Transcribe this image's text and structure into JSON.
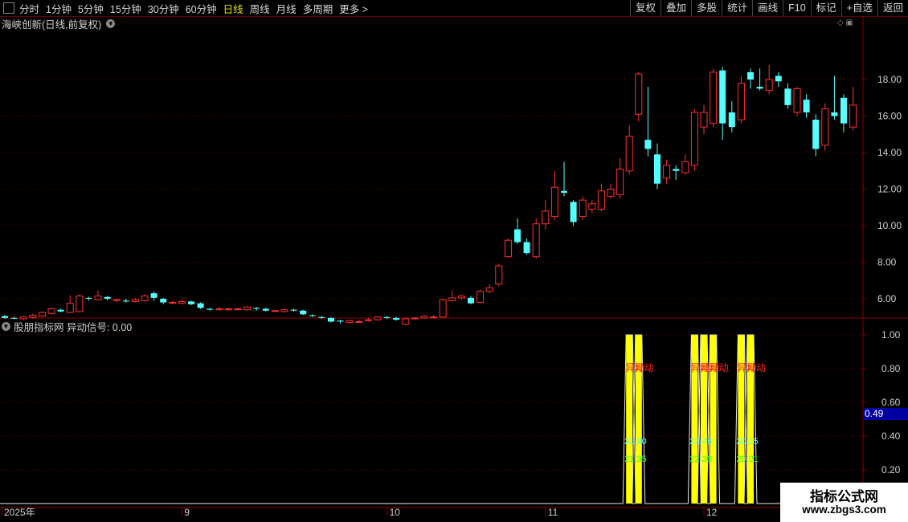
{
  "toolbar": {
    "periods": [
      {
        "label": "分时",
        "active": false
      },
      {
        "label": "1分钟",
        "active": false
      },
      {
        "label": "5分钟",
        "active": false
      },
      {
        "label": "15分钟",
        "active": false
      },
      {
        "label": "30分钟",
        "active": false
      },
      {
        "label": "60分钟",
        "active": false
      },
      {
        "label": "日线",
        "active": true
      },
      {
        "label": "周线",
        "active": false
      },
      {
        "label": "月线",
        "active": false
      },
      {
        "label": "多周期",
        "active": false
      },
      {
        "label": "更多 >",
        "active": false
      }
    ],
    "right_buttons": [
      "复权",
      "叠加",
      "多股",
      "统计",
      "画线",
      "F10",
      "标记",
      "+自选",
      "返回"
    ]
  },
  "main_chart": {
    "title": "海峡创新(日线,前复权)",
    "price_axis": [
      "18.00",
      "16.00",
      "14.00",
      "12.00",
      "10.00",
      "8.00",
      "6.00"
    ],
    "price_values": [
      18,
      16,
      14,
      12,
      10,
      8,
      6
    ],
    "up_color": "#ff3030",
    "down_color": "#54ffff",
    "candles": [
      [
        5.05,
        4.95,
        5.12,
        4.9
      ],
      [
        4.95,
        4.92,
        5.02,
        4.88
      ],
      [
        4.9,
        5.0,
        5.05,
        4.85
      ],
      [
        4.98,
        5.1,
        5.18,
        4.92
      ],
      [
        5.05,
        5.25,
        5.3,
        5.0
      ],
      [
        5.2,
        5.45,
        5.5,
        5.15
      ],
      [
        5.4,
        5.3,
        5.45,
        5.25
      ],
      [
        5.25,
        5.75,
        6.2,
        5.2
      ],
      [
        5.3,
        6.15,
        6.25,
        5.25
      ],
      [
        6.05,
        6.0,
        6.1,
        5.9
      ],
      [
        5.95,
        6.15,
        6.45,
        5.9
      ],
      [
        6.1,
        6.0,
        6.15,
        5.9
      ],
      [
        5.95,
        5.95,
        6.0,
        5.8
      ],
      [
        5.9,
        5.85,
        6.0,
        5.8
      ],
      [
        5.85,
        5.95,
        6.05,
        5.8
      ],
      [
        5.9,
        6.15,
        6.25,
        5.85
      ],
      [
        6.3,
        6.05,
        6.4,
        5.9
      ],
      [
        6.0,
        5.8,
        6.05,
        5.7
      ],
      [
        5.8,
        5.8,
        5.9,
        5.7
      ],
      [
        5.75,
        5.85,
        5.95,
        5.7
      ],
      [
        5.85,
        5.7,
        5.9,
        5.65
      ],
      [
        5.75,
        5.5,
        5.8,
        5.45
      ],
      [
        5.45,
        5.4,
        5.5,
        5.35
      ],
      [
        5.4,
        5.45,
        5.55,
        5.35
      ],
      [
        5.4,
        5.45,
        5.5,
        5.35
      ],
      [
        5.45,
        5.45,
        5.5,
        5.35
      ],
      [
        5.4,
        5.55,
        5.6,
        5.35
      ],
      [
        5.5,
        5.45,
        5.55,
        5.35
      ],
      [
        5.45,
        5.35,
        5.5,
        5.3
      ],
      [
        5.35,
        5.35,
        5.4,
        5.3
      ],
      [
        5.3,
        5.4,
        5.45,
        5.25
      ],
      [
        5.4,
        5.35,
        5.45,
        5.3
      ],
      [
        5.35,
        5.15,
        5.4,
        5.1
      ],
      [
        5.1,
        5.05,
        5.15,
        5.0
      ],
      [
        5.0,
        4.95,
        5.05,
        4.9
      ],
      [
        4.95,
        4.75,
        5.0,
        4.7
      ],
      [
        4.8,
        4.75,
        4.85,
        4.65
      ],
      [
        4.7,
        4.8,
        4.85,
        4.65
      ],
      [
        4.75,
        4.75,
        4.85,
        4.7
      ],
      [
        4.8,
        4.85,
        4.95,
        4.75
      ],
      [
        4.85,
        5.0,
        5.05,
        4.8
      ],
      [
        5.0,
        4.95,
        5.05,
        4.9
      ],
      [
        4.95,
        4.85,
        5.0,
        4.8
      ],
      [
        4.6,
        4.9,
        4.95,
        4.55
      ],
      [
        4.9,
        4.95,
        5.0,
        4.85
      ],
      [
        4.95,
        5.05,
        5.1,
        4.9
      ],
      [
        5.0,
        5.0,
        5.1,
        4.95
      ],
      [
        5.0,
        5.95,
        6.0,
        4.95
      ],
      [
        5.9,
        6.05,
        6.45,
        5.85
      ],
      [
        6.05,
        6.15,
        6.2,
        5.95
      ],
      [
        6.05,
        5.75,
        6.15,
        5.7
      ],
      [
        5.8,
        6.4,
        6.5,
        5.75
      ],
      [
        6.4,
        6.6,
        6.8,
        6.3
      ],
      [
        6.8,
        7.8,
        7.9,
        6.7
      ],
      [
        8.3,
        9.2,
        9.3,
        8.25
      ],
      [
        9.8,
        9.1,
        10.4,
        9.0
      ],
      [
        9.1,
        8.5,
        9.3,
        8.4
      ],
      [
        8.3,
        10.1,
        10.4,
        8.2
      ],
      [
        10.1,
        10.8,
        11.4,
        9.8
      ],
      [
        10.5,
        12.1,
        13.0,
        10.3
      ],
      [
        11.9,
        11.8,
        13.5,
        11.6
      ],
      [
        11.3,
        10.2,
        11.4,
        10.0
      ],
      [
        10.5,
        11.4,
        11.6,
        10.3
      ],
      [
        10.9,
        11.2,
        11.4,
        10.7
      ],
      [
        10.9,
        11.9,
        12.3,
        10.8
      ],
      [
        11.6,
        12.0,
        12.3,
        11.5
      ],
      [
        11.7,
        13.1,
        13.7,
        11.5
      ],
      [
        13.0,
        14.9,
        15.5,
        12.8
      ],
      [
        16.1,
        18.3,
        18.4,
        15.7
      ],
      [
        14.7,
        14.2,
        17.6,
        13.8
      ],
      [
        13.9,
        12.3,
        14.5,
        12.0
      ],
      [
        12.6,
        13.3,
        13.6,
        12.3
      ],
      [
        13.1,
        13.0,
        13.3,
        12.5
      ],
      [
        12.9,
        13.5,
        13.9,
        12.8
      ],
      [
        13.3,
        16.2,
        16.4,
        13.0
      ],
      [
        15.4,
        16.2,
        16.6,
        15.0
      ],
      [
        15.6,
        18.4,
        18.6,
        15.4
      ],
      [
        18.5,
        15.6,
        18.7,
        14.7
      ],
      [
        16.2,
        15.4,
        16.8,
        15.1
      ],
      [
        15.8,
        17.8,
        18.2,
        15.6
      ],
      [
        18.4,
        18.0,
        18.6,
        17.5
      ],
      [
        17.6,
        17.5,
        18.6,
        17.4
      ],
      [
        17.4,
        18.0,
        18.8,
        17.2
      ],
      [
        18.2,
        17.9,
        18.4,
        17.6
      ],
      [
        17.5,
        16.6,
        17.8,
        16.4
      ],
      [
        16.2,
        17.5,
        17.6,
        16.0
      ],
      [
        16.9,
        16.2,
        17.2,
        15.9
      ],
      [
        15.8,
        14.2,
        16.1,
        13.8
      ],
      [
        14.4,
        16.4,
        16.7,
        14.1
      ],
      [
        16.2,
        16.0,
        18.2,
        15.8
      ],
      [
        17.0,
        15.6,
        17.2,
        15.1
      ],
      [
        15.4,
        16.6,
        17.6,
        15.2
      ]
    ],
    "x_axis_labels": [
      {
        "label": "2025年",
        "idx": 0
      },
      {
        "label": "9",
        "idx": 19
      },
      {
        "label": "10",
        "idx": 41
      },
      {
        "label": "11",
        "idx": 58
      },
      {
        "label": "12",
        "idx": 75
      }
    ]
  },
  "indicator": {
    "title": "股朋指标网 异动信号: 0.00",
    "axis": [
      "1.00",
      "0.80",
      "0.60",
      "0.40",
      "0.20"
    ],
    "axis_values": [
      1.0,
      0.8,
      0.6,
      0.4,
      0.2
    ],
    "cursor_value": "0.49",
    "signal_color": "#ffff00",
    "signal_label": "异动",
    "signal_bars": [
      67,
      68,
      74,
      75,
      76,
      79,
      80
    ],
    "signal_groups": [
      {
        "labels": [
          "异动",
          "异动"
        ],
        "num_cyan": "21.80",
        "num_green": "21.95"
      },
      {
        "labels": [
          "异动",
          "异动",
          "异动"
        ],
        "num_cyan": "22.48",
        "num_green": "22.36"
      },
      {
        "labels": [
          "异动",
          "异动"
        ],
        "num_cyan": "20.15",
        "num_green": "20.21"
      }
    ]
  },
  "watermark": {
    "line1": "指标公式网",
    "line2": "www.zbgs3.com"
  }
}
